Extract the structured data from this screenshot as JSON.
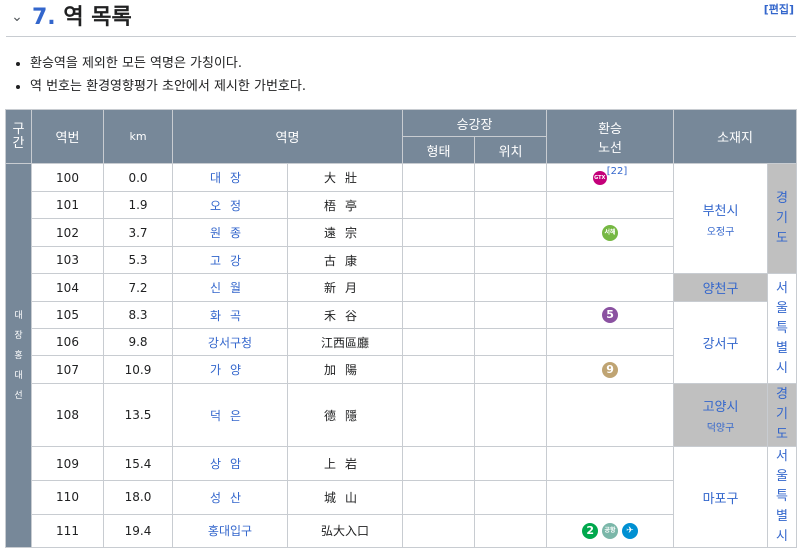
{
  "section": {
    "number": "7.",
    "title": "역 목록",
    "edit": "[편집]"
  },
  "notes": [
    "환승역을 제외한 모든 역명은 가칭이다.",
    "역 번호는 환경영향평가 초안에서 제시한 가번호다."
  ],
  "table": {
    "headers": {
      "section_chars": [
        "구",
        "간"
      ],
      "number": "역번",
      "km": "km",
      "name": "역명",
      "platform": "승강장",
      "platform_type": "형태",
      "platform_pos": "위치",
      "transfer": [
        "환승",
        "노선"
      ],
      "location": "소재지"
    },
    "section_name": [
      "대",
      "장",
      "홍",
      "대",
      "선"
    ],
    "rows": [
      {
        "no": "100",
        "km": "0.0",
        "name": "대장",
        "hanja": "大壯",
        "transfer": [
          "GTX-B"
        ],
        "ref": "[22]"
      },
      {
        "no": "101",
        "km": "1.9",
        "name": "오정",
        "hanja": "梧亭",
        "transfer": []
      },
      {
        "no": "102",
        "km": "3.7",
        "name": "원종",
        "hanja": "遠宗",
        "transfer": [
          "서해"
        ]
      },
      {
        "no": "103",
        "km": "5.3",
        "name": "고강",
        "hanja": "古康",
        "transfer": []
      },
      {
        "no": "104",
        "km": "7.2",
        "name": "신월",
        "hanja": "新月",
        "transfer": []
      },
      {
        "no": "105",
        "km": "8.3",
        "name": "화곡",
        "hanja": "禾谷",
        "transfer": [
          "5"
        ]
      },
      {
        "no": "106",
        "km": "9.8",
        "name": "강서구청",
        "hanja": "江西區廳",
        "transfer": []
      },
      {
        "no": "107",
        "km": "10.9",
        "name": "가양",
        "hanja": "加陽",
        "transfer": [
          "9"
        ]
      },
      {
        "no": "108",
        "km": "13.5",
        "name": "덕은",
        "hanja": "德隱",
        "transfer": []
      },
      {
        "no": "109",
        "km": "15.4",
        "name": "상암",
        "hanja": "上岩",
        "transfer": []
      },
      {
        "no": "110",
        "km": "18.0",
        "name": "성산",
        "hanja": "城山",
        "transfer": []
      },
      {
        "no": "111",
        "km": "19.4",
        "name": "홍대입구",
        "hanja": "弘大入口",
        "transfer": [
          "2",
          "공항",
          "공항철도"
        ]
      }
    ],
    "locations": {
      "bucheon": {
        "city": "부천시",
        "district": "오정구"
      },
      "yangcheon": "양천구",
      "gangseo": "강서구",
      "goyang": {
        "city": "고양시",
        "district": "덕양구"
      },
      "mapo": "마포구",
      "gyeonggi1": [
        "경",
        "기",
        "도"
      ],
      "seoul1": [
        "서",
        "울",
        "특",
        "별",
        "시"
      ],
      "gyeonggi2": [
        "경",
        "기",
        "도"
      ],
      "seoul2": [
        "서",
        "울",
        "특",
        "별",
        "시"
      ]
    },
    "badge_text": {
      "gtx": "GTX",
      "seohae": "서해",
      "line5": "5",
      "line9": "9",
      "line2": "2",
      "airport1": "공항",
      "airport2": "✈"
    }
  }
}
